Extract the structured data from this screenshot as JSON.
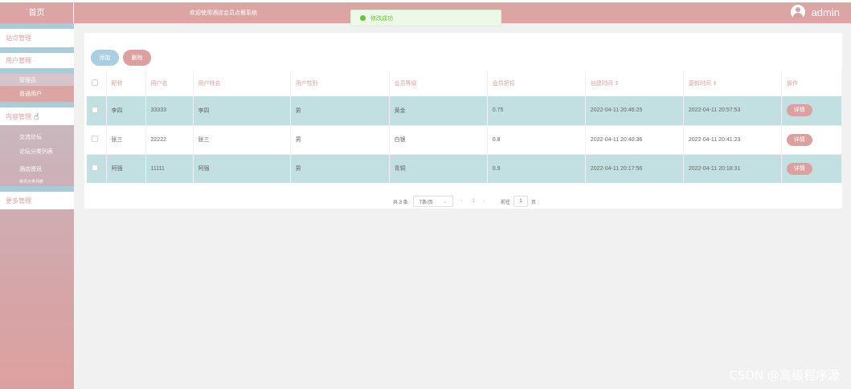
{
  "header": {
    "home_label": "首页",
    "welcome_text": "欢迎使用酒店会员点餐系统",
    "username": "admin",
    "toast_text": "修改成功"
  },
  "sidebar": {
    "groups": [
      {
        "label": "站点管理"
      },
      {
        "label": "用户管理"
      },
      {
        "label": "内容管理"
      },
      {
        "label": "更多管理"
      }
    ],
    "user_items": [
      {
        "label": "管理员"
      },
      {
        "label": "普通用户"
      }
    ],
    "content_items": [
      {
        "label": "交流论坛"
      },
      {
        "label": "论坛分类列表"
      },
      {
        "label": "酒店资讯"
      },
      {
        "label": "资讯分类列表"
      }
    ]
  },
  "toolbar": {
    "add_label": "添加",
    "delete_label": "删除"
  },
  "table": {
    "headers": {
      "nickname": "昵称",
      "username": "用户名",
      "realname": "用户姓名",
      "gender": "用户性别",
      "level": "会员等级",
      "discount": "会员折扣",
      "created": "创建时间 ⇕",
      "updated": "更新时间 ⇕",
      "action": "操作"
    },
    "rows": [
      {
        "nickname": "李四",
        "username": "33333",
        "realname": "李四",
        "gender": "男",
        "level": "黄金",
        "discount": "0.75",
        "created": "2022-04-11 20:46:25",
        "updated": "2022-04-11 20:57:53",
        "action": "详情"
      },
      {
        "nickname": "张三",
        "username": "22222",
        "realname": "张三",
        "gender": "男",
        "level": "白银",
        "discount": "0.8",
        "created": "2022-04-11 20:40:36",
        "updated": "2022-04-11 20:41:23",
        "action": "详情"
      },
      {
        "nickname": "阿强",
        "username": "11111",
        "realname": "阿强",
        "gender": "男",
        "level": "青铜",
        "discount": "0.9",
        "created": "2022-04-11 20:17:56",
        "updated": "2022-04-11 20:18:31",
        "action": "详情"
      }
    ]
  },
  "pagination": {
    "total": "共 3 条",
    "page_size": "7条/页",
    "prev": "‹",
    "current_page": "1",
    "next": "›",
    "goto_label": "前往",
    "goto_value": "1",
    "goto_suffix": "页"
  },
  "watermark": "CSDN @高级程序源"
}
